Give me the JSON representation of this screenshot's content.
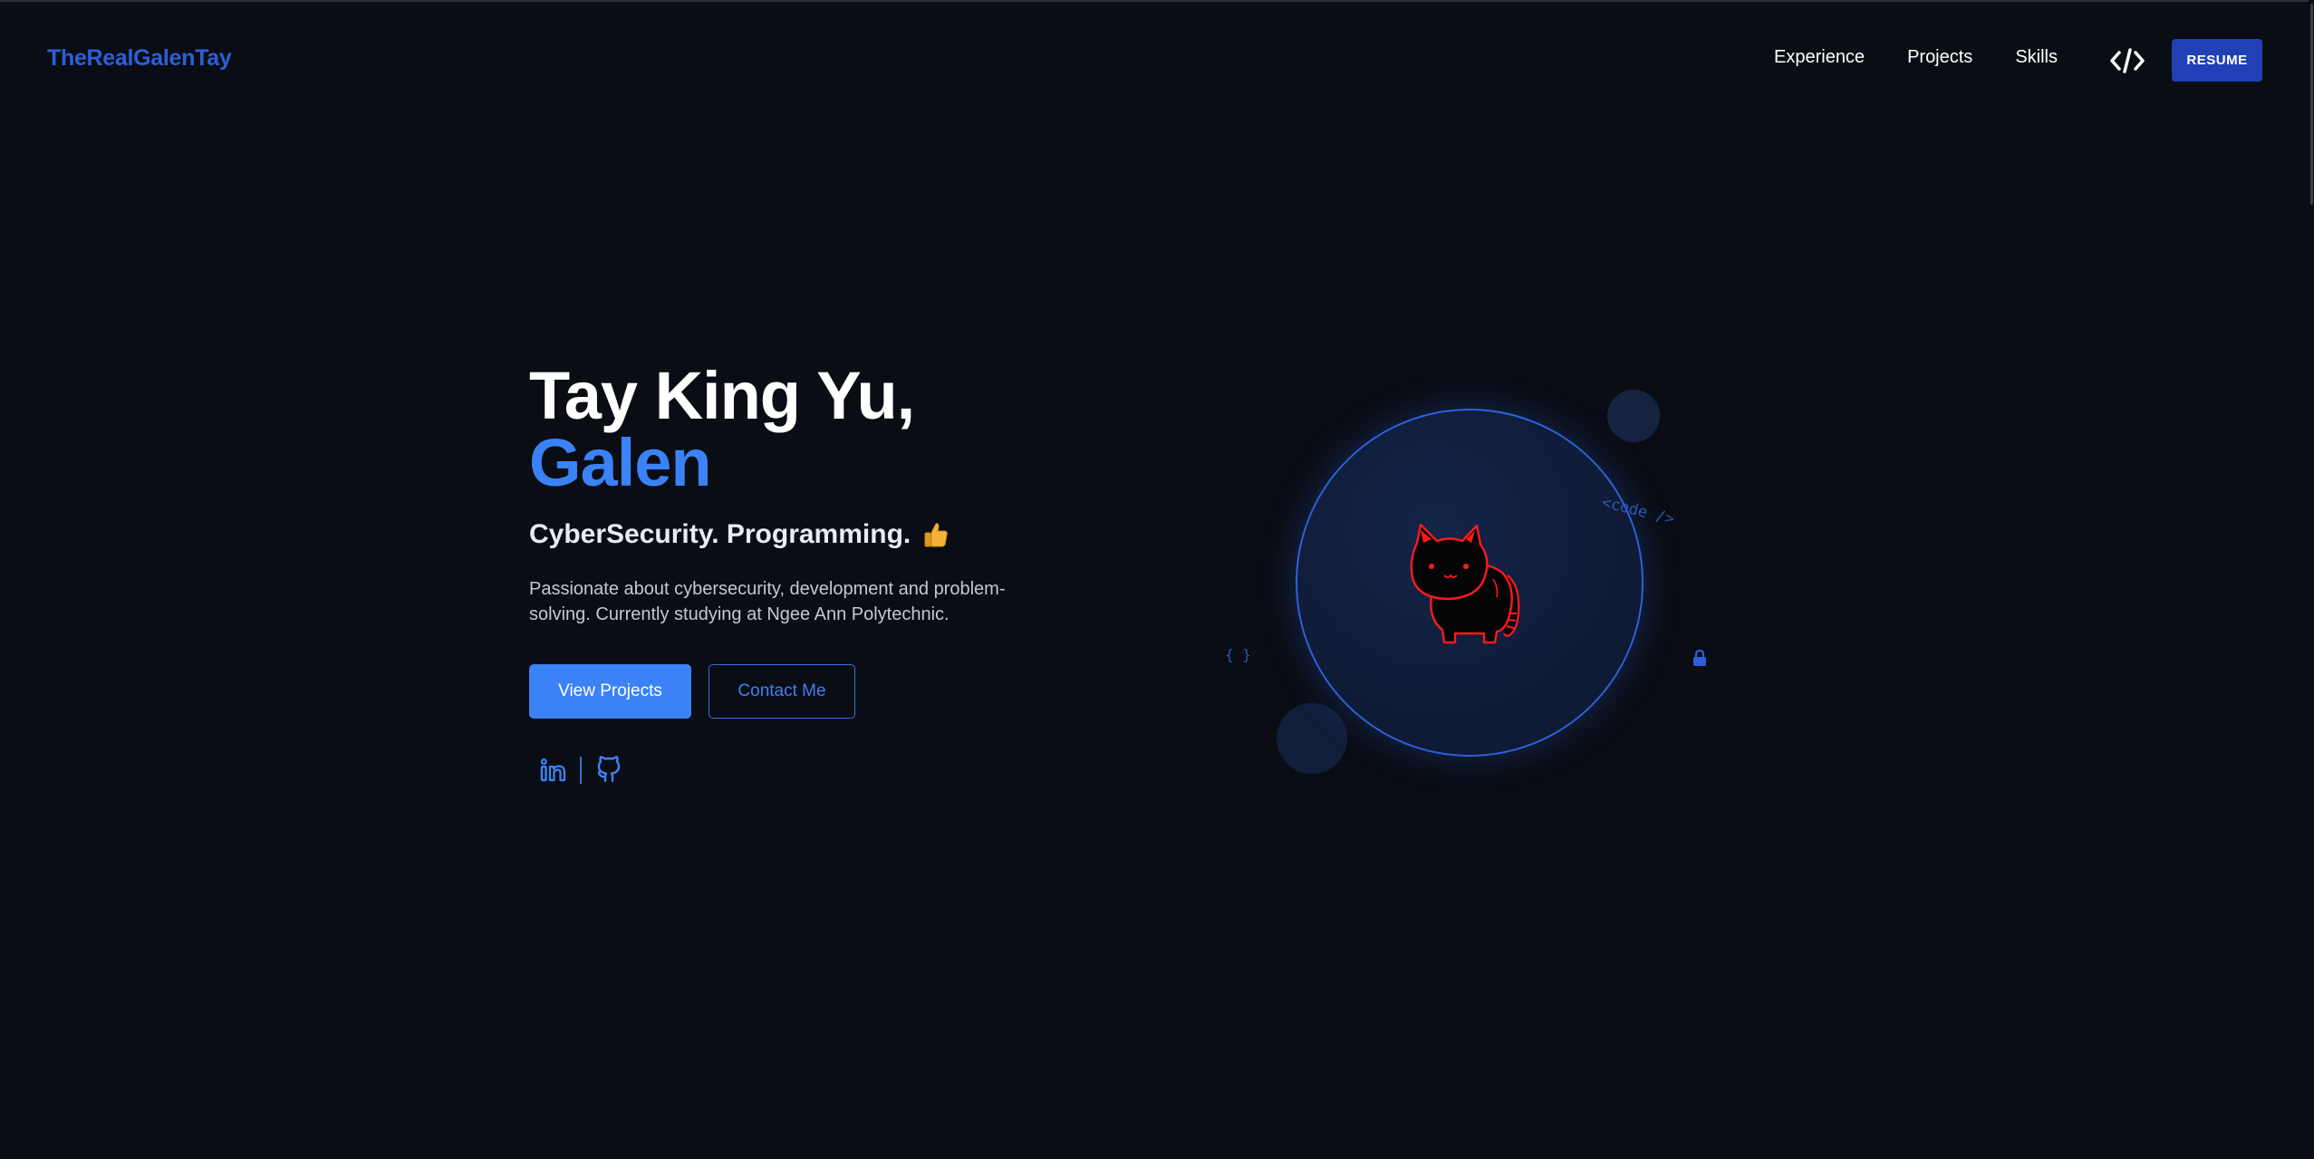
{
  "nav": {
    "logo": "TheRealGalenTay",
    "links": [
      "Experience",
      "Projects",
      "Skills"
    ],
    "code_icon": "code-brackets-icon",
    "resume_label": "RESUME"
  },
  "hero": {
    "name_line1": "Tay King Yu,",
    "name_line2": "Galen",
    "tagline": "CyberSecurity. Programming.",
    "tagline_icon": "thumbs-up-emoji-icon",
    "description": "Passionate about cybersecurity, development and problem-solving. Currently studying at Ngee Ann Polytechnic.",
    "primary_button": "View Projects",
    "secondary_button": "Contact Me",
    "socials": [
      "linkedin-icon",
      "github-icon"
    ]
  },
  "illustration": {
    "code_text": "<code />",
    "braces_text": "{ }",
    "lock_icon": "lock-icon",
    "mascot": "cat-icon"
  },
  "colors": {
    "background": "#0a0d14",
    "accent": "#3b82f6",
    "logo": "#2c5fd9",
    "resume_button": "#2140b5",
    "mascot_outline": "#ff1a1a"
  }
}
